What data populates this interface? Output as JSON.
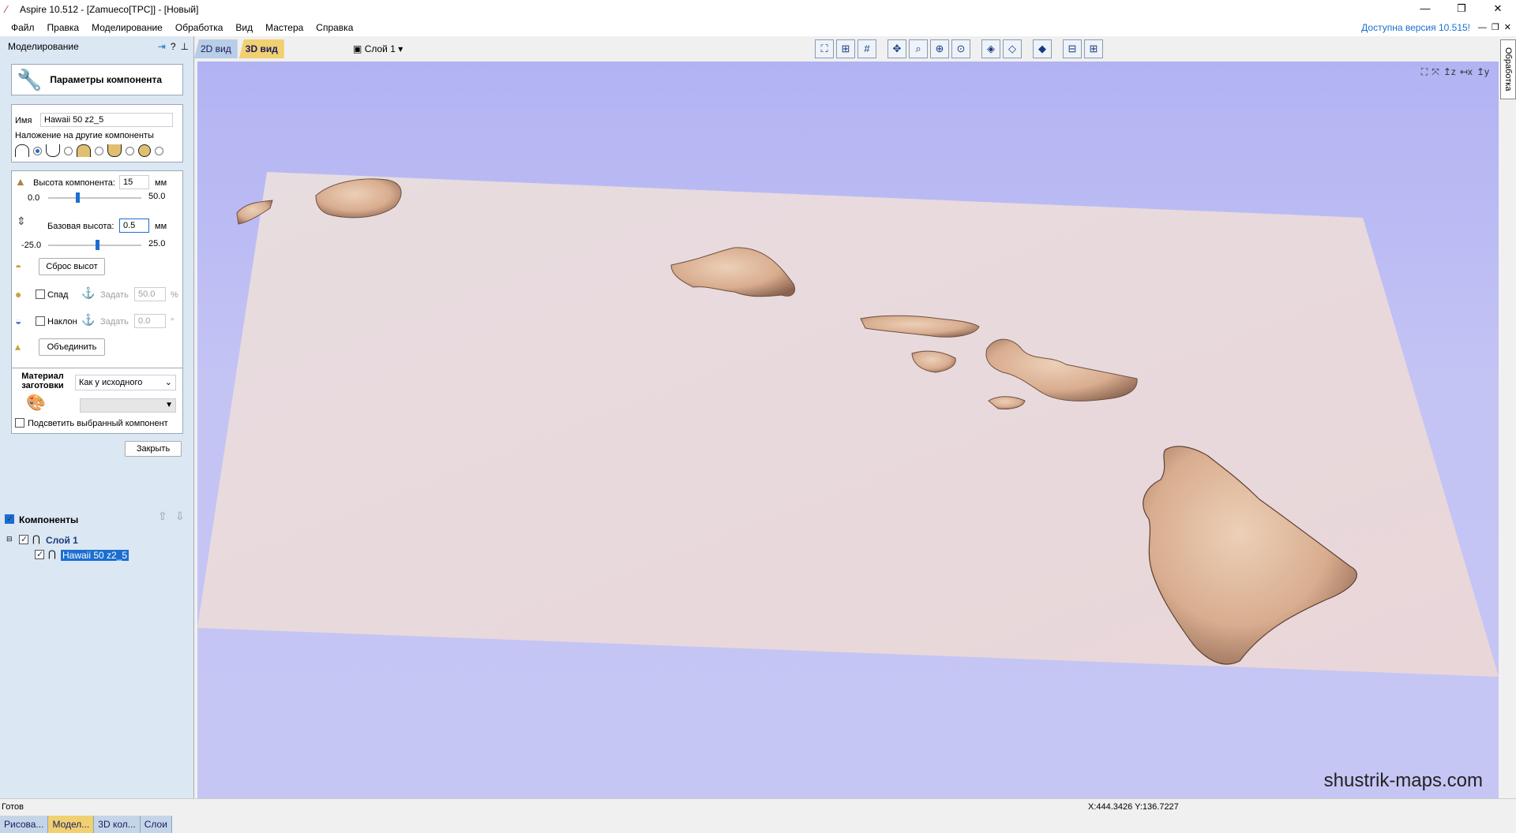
{
  "window": {
    "title": "Aspire 10.512 - [Zamueco[TPC]] - [Новый]",
    "minimize": "—",
    "maximize": "❐",
    "close": "✕"
  },
  "menu": {
    "items": [
      "Файл",
      "Правка",
      "Моделирование",
      "Обработка",
      "Вид",
      "Мастера",
      "Справка"
    ],
    "update_notice": "Доступна версия 10.515!"
  },
  "panel": {
    "title": "Моделирование",
    "header_button": "Параметры компонента",
    "name_label": "Имя",
    "name_value": "Hawaii 50 z2_5",
    "overlap_label": "Наложение на другие компоненты",
    "height_label": "Высота компонента:",
    "height_value": "15",
    "height_unit": "мм",
    "height_min": "0.0",
    "height_max": "50.0",
    "height_pos": 0.3,
    "base_label": "Базовая высота:",
    "base_value": "0.5",
    "base_unit": "мм",
    "base_min": "-25.0",
    "base_max": "25.0",
    "base_pos": 0.51,
    "reset_button": "Сброс высот",
    "fade_label": "Спад",
    "fade_set": "Задать",
    "fade_value": "50.0",
    "fade_unit": "%",
    "tilt_label": "Наклон",
    "tilt_set": "Задать",
    "tilt_value": "0.0",
    "tilt_unit": "°",
    "merge_button": "Объединить",
    "material_label": "Материал заготовки",
    "material_value": "Как у исходного",
    "highlight_label": "Подсветить выбранный компонент",
    "close_button": "Закрыть"
  },
  "components": {
    "title": "Компоненты",
    "layer": "Слой 1",
    "item": "Hawaii 50 z2_5"
  },
  "bottom_tabs": [
    "Рисова...",
    "Модел...",
    "3D кол...",
    "Слои"
  ],
  "view_tabs": [
    "2D вид",
    "3D вид"
  ],
  "layer_select": "Слой 1",
  "side_tab": "Обработка",
  "watermark": "shustrik-maps.com",
  "status": {
    "left": "Готов",
    "coords": "X:444.3426 Y:136.7227"
  }
}
